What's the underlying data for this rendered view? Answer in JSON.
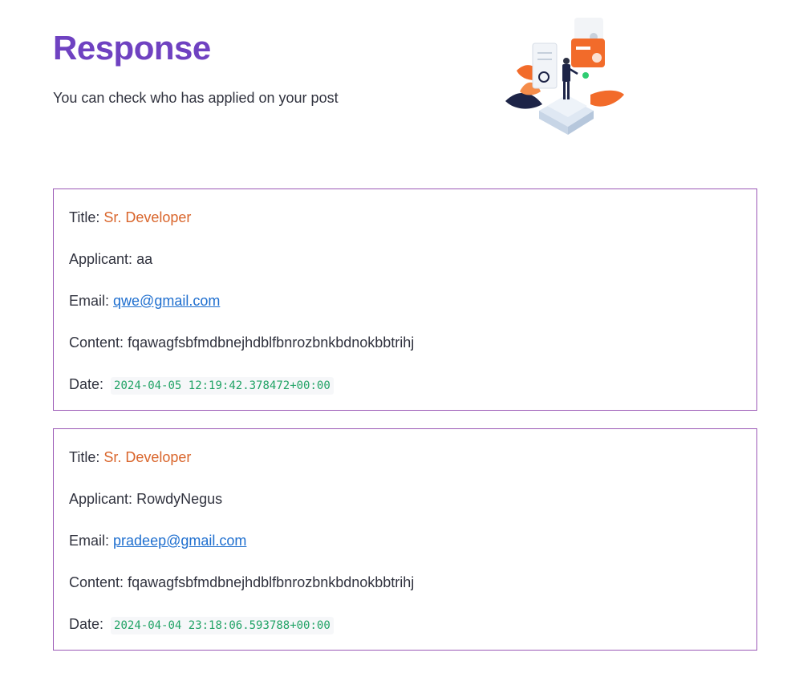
{
  "header": {
    "title": "Response",
    "subtitle": "You can check who has applied on your post"
  },
  "labels": {
    "title": "Title:",
    "applicant": "Applicant:",
    "email": "Email:",
    "content": "Content:",
    "date": "Date:"
  },
  "responses": [
    {
      "title": "Sr. Developer",
      "applicant": "aa",
      "email": "qwe@gmail.com",
      "content": "fqawagfsbfmdbnejhdblfbnrozbnkbdnokbbtrihj",
      "date": "2024-04-05 12:19:42.378472+00:00"
    },
    {
      "title": "Sr. Developer",
      "applicant": "RowdyNegus",
      "email": "pradeep@gmail.com",
      "content": "fqawagfsbfmdbnejhdblfbnrozbnkbdnokbbtrihj",
      "date": "2024-04-04 23:18:06.593788+00:00"
    }
  ],
  "colors": {
    "title": "#6f42c1",
    "card_border": "#9b59b6",
    "job_title": "#d9652b",
    "link": "#1f6fcf",
    "date_code": "#21a366"
  }
}
